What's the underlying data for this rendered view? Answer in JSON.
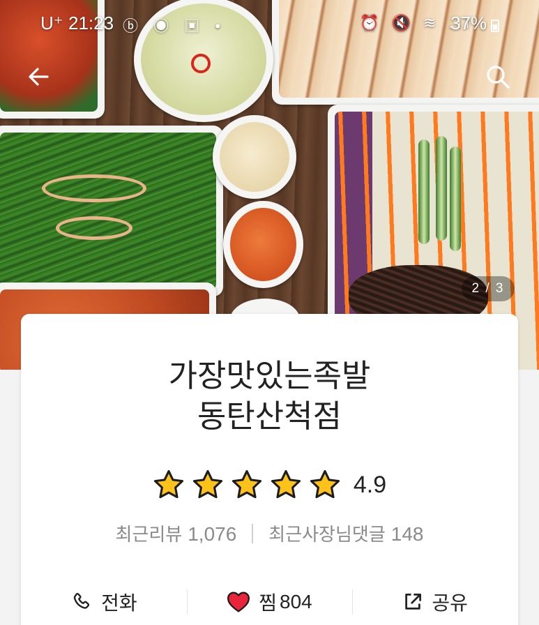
{
  "status_bar": {
    "carrier": "U⁺",
    "time": "21:23",
    "app_icons": "ⓑ ◉ ▣ •",
    "system_icons": "⏰ 🔇 ≋ .ıl",
    "battery": "37%"
  },
  "gallery": {
    "page_indicator": "2 / 3"
  },
  "store": {
    "name_line1": "가장맛있는족발",
    "name_line2": "동탄산척점",
    "rating": "4.9",
    "stars": 5,
    "review_label": "최근리뷰",
    "review_count": "1,076",
    "owner_reply_label": "최근사장님댓글",
    "owner_reply_count": "148"
  },
  "actions": {
    "call_label": "전화",
    "favorite_label": "찜",
    "favorite_count": "804",
    "share_label": "공유"
  },
  "colors": {
    "star": "#FFC21A",
    "heart": "#E8253A",
    "text_primary": "#222222",
    "text_secondary": "#8A8A8A"
  },
  "icons": {
    "back": "arrow-left-icon",
    "search": "search-icon",
    "call": "phone-icon",
    "favorite": "heart-icon",
    "share": "share-icon"
  }
}
